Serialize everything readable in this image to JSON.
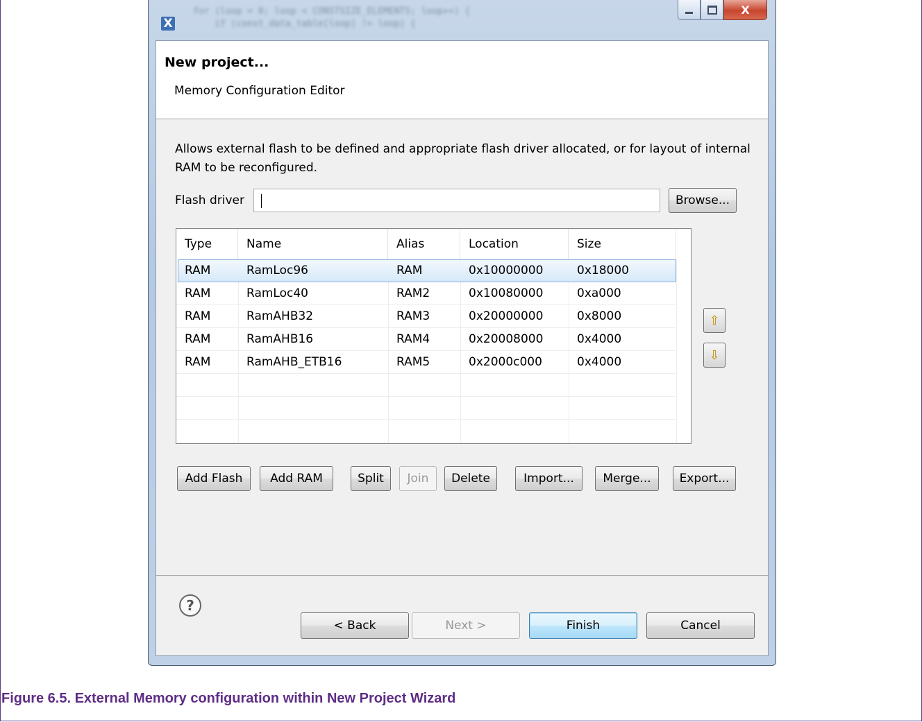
{
  "window": {
    "app_icon": "eclipse-x-icon",
    "controls": {
      "minimize": "minimize-icon",
      "maximize": "maximize-icon",
      "close_label": "X"
    }
  },
  "wizard": {
    "title": "New project...",
    "subtitle": "Memory Configuration Editor",
    "description": "Allows external flash to be defined and appropriate flash driver allocated, or for layout of internal RAM to be reconfigured.",
    "flash_driver_label": "Flash driver",
    "flash_driver_value": "",
    "browse_label": "Browse..."
  },
  "table": {
    "columns": [
      "Type",
      "Name",
      "Alias",
      "Location",
      "Size"
    ],
    "rows": [
      {
        "type": "RAM",
        "name": "RamLoc96",
        "alias": "RAM",
        "location": "0x10000000",
        "size": "0x18000",
        "selected": true
      },
      {
        "type": "RAM",
        "name": "RamLoc40",
        "alias": "RAM2",
        "location": "0x10080000",
        "size": "0xa000"
      },
      {
        "type": "RAM",
        "name": "RamAHB32",
        "alias": "RAM3",
        "location": "0x20000000",
        "size": "0x8000"
      },
      {
        "type": "RAM",
        "name": "RamAHB16",
        "alias": "RAM4",
        "location": "0x20008000",
        "size": "0x4000"
      },
      {
        "type": "RAM",
        "name": "RamAHB_ETB16",
        "alias": "RAM5",
        "location": "0x2000c000",
        "size": "0x4000"
      }
    ]
  },
  "actions": {
    "add_flash": "Add Flash",
    "add_ram": "Add RAM",
    "split": "Split",
    "join": "Join",
    "delete": "Delete",
    "import": "Import...",
    "merge": "Merge...",
    "export": "Export..."
  },
  "nav": {
    "back": "< Back",
    "next": "Next >",
    "finish": "Finish",
    "cancel": "Cancel",
    "help_glyph": "?"
  },
  "caption": "Figure 6.5. External Memory configuration within New Project Wizard"
}
